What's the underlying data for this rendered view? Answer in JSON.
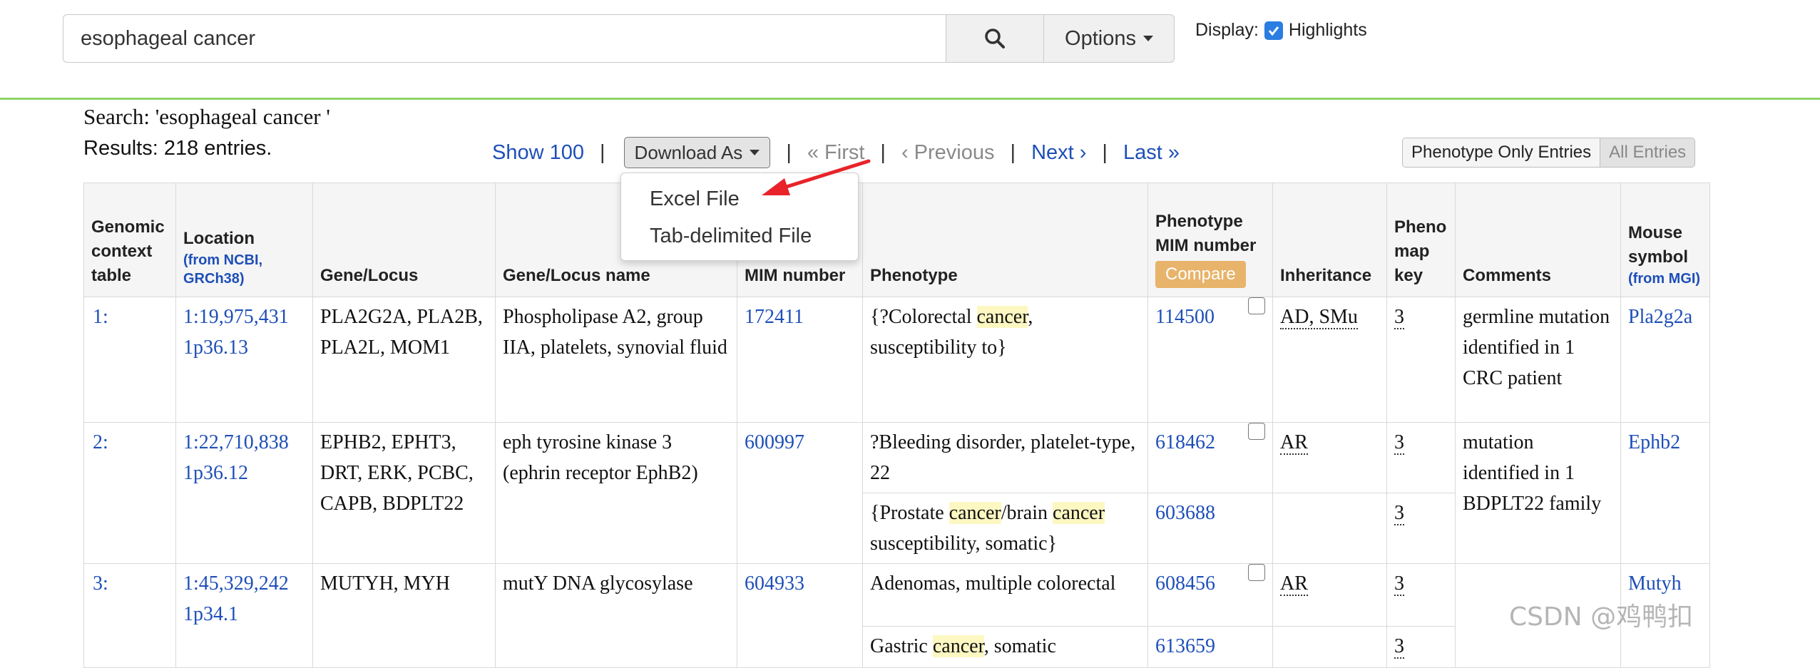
{
  "search": {
    "value": "esophageal cancer",
    "options_label": "Options"
  },
  "display": {
    "label": "Display:",
    "highlights_label": "Highlights",
    "highlights_checked": true
  },
  "summary": {
    "search_text": "Search: 'esophageal cancer '",
    "results_text": "Results: 218 entries."
  },
  "pager": {
    "show100": "Show 100",
    "download_label": "Download As",
    "first": "« First",
    "previous": "‹ Previous",
    "next": "Next ›",
    "last": "Last »",
    "sep": "|"
  },
  "download_menu": {
    "items": [
      "Excel File",
      "Tab-delimited File"
    ]
  },
  "view_toggle": {
    "phenotype_only": "Phenotype Only Entries",
    "all_entries": "All Entries"
  },
  "table": {
    "headers": {
      "genomic": "Genomic context table",
      "location": "Location",
      "location_sub": "(from NCBI, GRCh38)",
      "gene_locus": "Gene/Locus",
      "gene_locus_name": "Gene/Locus name",
      "mim_number": "MIM number",
      "phenotype": "Phenotype",
      "phenotype_mim": "Phenotype MIM number",
      "compare": "Compare",
      "inheritance": "Inheritance",
      "pheno_map_key": "Pheno map key",
      "comments": "Comments",
      "mouse_symbol": "Mouse symbol",
      "mouse_sub": "(from MGI)"
    },
    "rows": [
      {
        "index": "1:",
        "location": "1:19,975,431",
        "band": "1p36.13",
        "gene": "PLA2G2A, PLA2B, PLA2L, MOM1",
        "gene_name": "Phospholipase A2, group IIA, platelets, synovial fluid",
        "mim": "172411",
        "phen1_pre": "{?Colorectal ",
        "phen1_hl": "cancer",
        "phen1_post": ", susceptibility to}",
        "phen1_mim": "114500",
        "phen1_inh": "AD, SMu",
        "phen1_key": "3",
        "comments": "germline mutation identified in 1 CRC patient",
        "mouse": "Pla2g2a"
      },
      {
        "index": "2:",
        "location": "1:22,710,838",
        "band": "1p36.12",
        "gene": "EPHB2, EPHT3, DRT, ERK, PCBC, CAPB, BDPLT22",
        "gene_name": "eph tyrosine kinase 3 (ephrin receptor EphB2)",
        "mim": "600997",
        "phen1": "?Bleeding disorder, platelet-type, 22",
        "phen1_mim": "618462",
        "phen1_inh": "AR",
        "phen1_key": "3",
        "phen2_pre": "{Prostate ",
        "phen2_hl1": "cancer",
        "phen2_mid": "/brain ",
        "phen2_hl2": "cancer",
        "phen2_post": " susceptibility, somatic}",
        "phen2_mim": "603688",
        "phen2_key": "3",
        "comments": "mutation identified in 1 BDPLT22 family",
        "mouse": "Ephb2"
      },
      {
        "index": "3:",
        "location": "1:45,329,242",
        "band": "1p34.1",
        "gene": "MUTYH, MYH",
        "gene_name": "mutY DNA glycosylase",
        "mim": "604933",
        "phen1": "Adenomas, multiple colorectal",
        "phen1_mim": "608456",
        "phen1_inh": "AR",
        "phen1_key": "3",
        "phen2_pre": "Gastric ",
        "phen2_hl": "cancer",
        "phen2_post": ", somatic",
        "phen2_mim": "613659",
        "phen2_key": "3",
        "mouse": "Mutyh"
      }
    ]
  },
  "watermark": "CSDN @鸡鸭扣",
  "colors": {
    "link": "#1e4fb8",
    "highlight": "#fdf7c2",
    "compare": "#e8b36a",
    "divider": "#8fd36b",
    "arrow": "#e8232a"
  }
}
